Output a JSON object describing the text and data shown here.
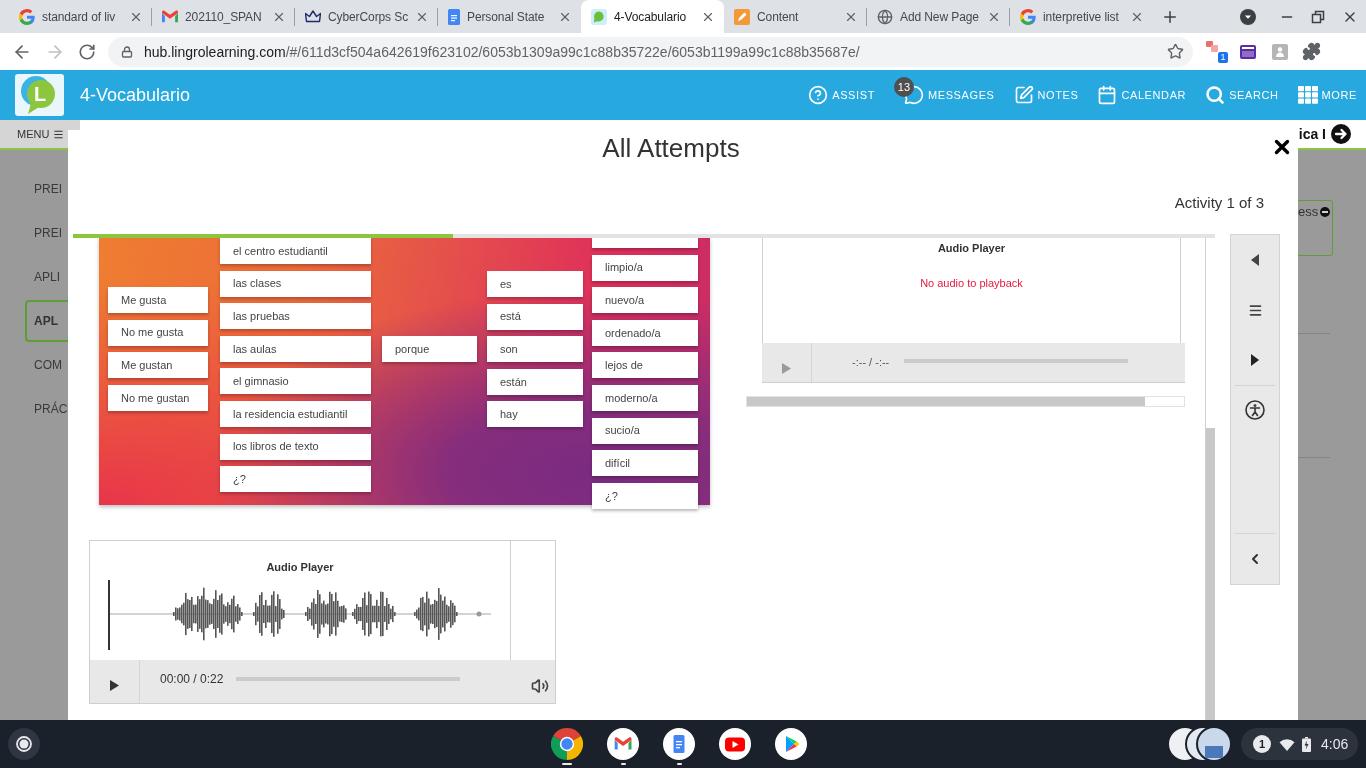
{
  "browser": {
    "tabs": [
      {
        "title": "standard of liv",
        "selected": false
      },
      {
        "title": "202110_SPAN",
        "selected": false
      },
      {
        "title": "CyberCorps Sc",
        "selected": false
      },
      {
        "title": "Personal State",
        "selected": false
      },
      {
        "title": "4-Vocabulario",
        "selected": true
      },
      {
        "title": "Content",
        "selected": false
      },
      {
        "title": "Add New Page",
        "selected": false
      },
      {
        "title": "interpretive list",
        "selected": false
      }
    ],
    "address": {
      "host": "hub.lingrolearning.com",
      "path": "/#/611d3cf504a642619f623102/6053b1309a99c1c88b35722e/6053b1199a99c1c88b35687e/"
    },
    "extension_badge": "1"
  },
  "app_header": {
    "logo_letter": "L",
    "title": "4-Vocabulario",
    "nav": [
      {
        "label": "ASSIST"
      },
      {
        "label": "MESSAGES",
        "badge": "13"
      },
      {
        "label": "NOTES"
      },
      {
        "label": "CALENDAR"
      },
      {
        "label": "SEARCH"
      },
      {
        "label": "MORE"
      }
    ]
  },
  "course_bar": {
    "menu_label": "MENU",
    "next_label": "ica I"
  },
  "sidebar": {
    "items": [
      {
        "label": "PREI",
        "selected": false
      },
      {
        "label": "PREI",
        "selected": false
      },
      {
        "label": "APLI",
        "selected": false
      },
      {
        "label": "APL",
        "selected": true
      },
      {
        "label": "COM",
        "selected": false
      },
      {
        "label": "PRÁC",
        "selected": false
      }
    ]
  },
  "side_card": {
    "label": "ess"
  },
  "modal": {
    "title": "All Attempts",
    "counter": "Activity 1 of 3",
    "progress": {
      "level": 0.333
    },
    "vocabulary_image": {
      "columns": [
        {
          "words": [
            "Me gusta",
            "No me gusta",
            "Me gustan",
            "No me gustan"
          ]
        },
        {
          "words": [
            "el centro estudiantil",
            "las clases",
            "las pruebas",
            "las aulas",
            "el gimnasio",
            "la residencia estudiantil",
            "los libros de texto",
            "¿?"
          ]
        },
        {
          "words": [
            "porque"
          ]
        },
        {
          "words": [
            "es",
            "está",
            "son",
            "están",
            "hay"
          ]
        },
        {
          "words": [
            "limpio/a",
            "nuevo/a",
            "ordenado/a",
            "lejos de",
            "moderno/a",
            "sucio/a",
            "difícil",
            "¿?"
          ]
        }
      ]
    },
    "response_player": {
      "kind": "empty",
      "title": "Audio Player",
      "message": "No audio to playback",
      "time": "-:-- / -:--"
    },
    "recording_player": {
      "kind": "waveform",
      "title": "Audio Player",
      "time": "00:00 / 0:22"
    }
  },
  "shelf": {
    "apps": [
      {
        "open": true,
        "active": true
      },
      {
        "open": true,
        "active": false
      },
      {
        "open": true,
        "active": false
      },
      {
        "open": false,
        "active": false
      },
      {
        "open": false,
        "active": false
      }
    ],
    "notification_count": "1",
    "time": "4:06"
  }
}
